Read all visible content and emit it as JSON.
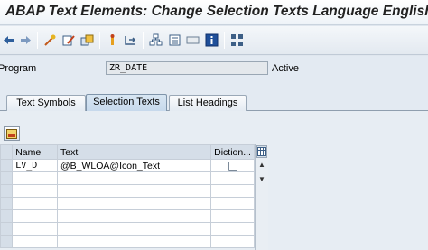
{
  "window": {
    "title": "ABAP Text Elements: Change Selection Texts Language English"
  },
  "toolbar": {
    "icons": [
      "back-arrow",
      "forward-arrow",
      "other-object",
      "display-change",
      "activate",
      "where-used",
      "navigate",
      "display-object-list",
      "hierarchy",
      "blank",
      "info",
      "compare"
    ]
  },
  "header": {
    "program_label": "Program",
    "program_value": "ZR_DATE",
    "status": "Active"
  },
  "tabs": [
    {
      "label": "Text Symbols",
      "active": false
    },
    {
      "label": "Selection Texts",
      "active": true
    },
    {
      "label": "List Headings",
      "active": false
    }
  ],
  "grid": {
    "columns": [
      "Name",
      "Text",
      "Diction..."
    ],
    "rows": [
      {
        "name": "LV_D",
        "text": "@B_WLOA@Icon_Text",
        "dictionary": false
      }
    ]
  }
}
